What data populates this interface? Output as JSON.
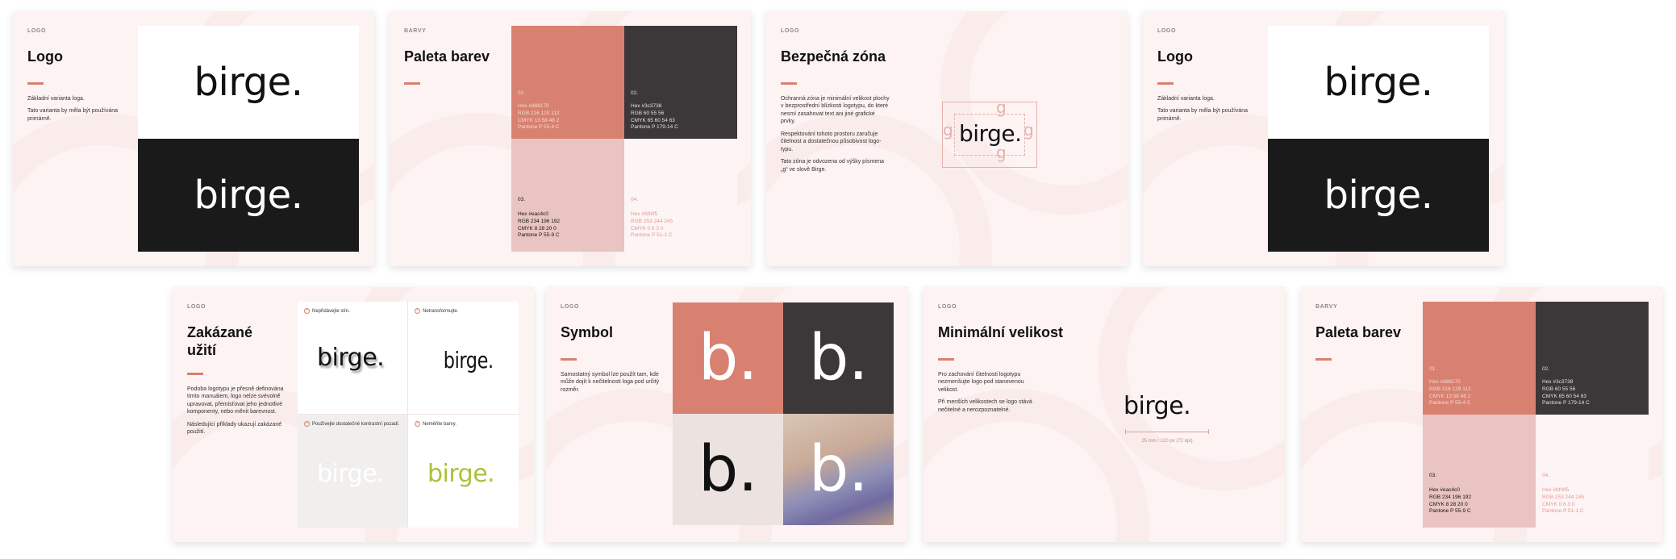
{
  "colors": {
    "coral": "#d88170",
    "dark": "#3c3738",
    "pink": "#eac4c0",
    "cream": "#fdf4f5",
    "lime": "#a8c23a"
  },
  "brand": {
    "wordmark": "birge.",
    "symbol": "b."
  },
  "slide1": {
    "eyebrow": "LOGO",
    "title": "Logo",
    "p1": "Základní varianta loga.",
    "p2": "Tato varianta by měla být používána primárně."
  },
  "slide2": {
    "eyebrow": "BARVY",
    "title": "Paleta barev",
    "swatches": [
      {
        "num": "01.",
        "hex": "Hex #d88170",
        "rgb": "RGB 216 129 112",
        "cmyk": "CMYK 13 58 48 2",
        "pantone": "Pantone P 55-4 C"
      },
      {
        "num": "02.",
        "hex": "Hex #3c3738",
        "rgb": "RGB 60 55 56",
        "cmyk": "CMYK 65 60 54 63",
        "pantone": "Pantone P 179-14 C"
      },
      {
        "num": "03.",
        "hex": "Hex #eac4c0",
        "rgb": "RGB 234 196 192",
        "cmyk": "CMYK 8 28 20 0",
        "pantone": "Pantone P 55-9 C"
      },
      {
        "num": "04.",
        "hex": "Hex #fdf4f5",
        "rgb": "RGB 253 244 245",
        "cmyk": "CMYK 0 6 3 0",
        "pantone": "Pantone P 51-1 C"
      }
    ]
  },
  "slide3": {
    "eyebrow": "LOGO",
    "title": "Bezpečná zóna",
    "p1": "Ochranná zóna je minimální velikost plochy v bezprostřední blízkosti logotypu, do které nesmí zasahovat text ani jiné grafické prvky.",
    "p2": "Respektování tohoto prostoru zaručuje čitelnost a dostatečnou působivost logo-typu.",
    "p3": "Tato zóna je odvozena od výšky písmena „g“ ve slově Birge.",
    "g": "g"
  },
  "slide4": {
    "eyebrow": "LOGO",
    "title": "Logo",
    "p1": "Základní varianta loga.",
    "p2": "Tato varianta by měla být používána primárně."
  },
  "slide5": {
    "eyebrow": "LOGO",
    "title": "Zakázané užití",
    "p1": "Podoba logotypu je přesně definována tímto manuálem, logo nelze svévolně upravovat, přemisťovat jeho jednotlivé komponenty, nebo měnit barevnost.",
    "p2": "Následující příklady ukazují zakázané použití.",
    "cells": [
      {
        "label": "Nepřidávejte stín.",
        "x": "×"
      },
      {
        "label": "Netransformujte.",
        "x": "×"
      },
      {
        "label": "Používejte dostatečné kontrastní pozadí.",
        "x": "×"
      },
      {
        "label": "Neměňte barvy.",
        "x": "×"
      }
    ]
  },
  "slide6": {
    "eyebrow": "LOGO",
    "title": "Symbol",
    "p1": "Samostatný symbol lze použít tam, kde může dojít k nečitelnosti loga pod určitý rozměr."
  },
  "slide7": {
    "eyebrow": "LOGO",
    "title": "Minimální velikost",
    "p1": "Pro zachování čitelnosti logotypu nezmenšujte logo pod stanovenou velikost.",
    "p2": "Při menších velikostech se logo stává nečitelné a nerozpoznatelné.",
    "dimension": "25 mm / 120 px (72 dpi)"
  },
  "slide8": {
    "eyebrow": "BARVY",
    "title": "Paleta barev",
    "swatches": [
      {
        "num": "01.",
        "hex": "Hex #d88170",
        "rgb": "RGB 216 129 112",
        "cmyk": "CMYK 13 58 48 2",
        "pantone": "Pantone P 55-4 C"
      },
      {
        "num": "02.",
        "hex": "Hex #3c3738",
        "rgb": "RGB 60 55 56",
        "cmyk": "CMYK 65 60 54 63",
        "pantone": "Pantone P 179-14 C"
      },
      {
        "num": "03.",
        "hex": "Hex #eac4c0",
        "rgb": "RGB 234 196 192",
        "cmyk": "CMYK 8 28 20 0",
        "pantone": "Pantone P 55-9 C"
      },
      {
        "num": "04.",
        "hex": "Hex #fdf4f5",
        "rgb": "RGB 253 244 245",
        "cmyk": "CMYK 0 6 3 0",
        "pantone": "Pantone P 51-1 C"
      }
    ]
  }
}
